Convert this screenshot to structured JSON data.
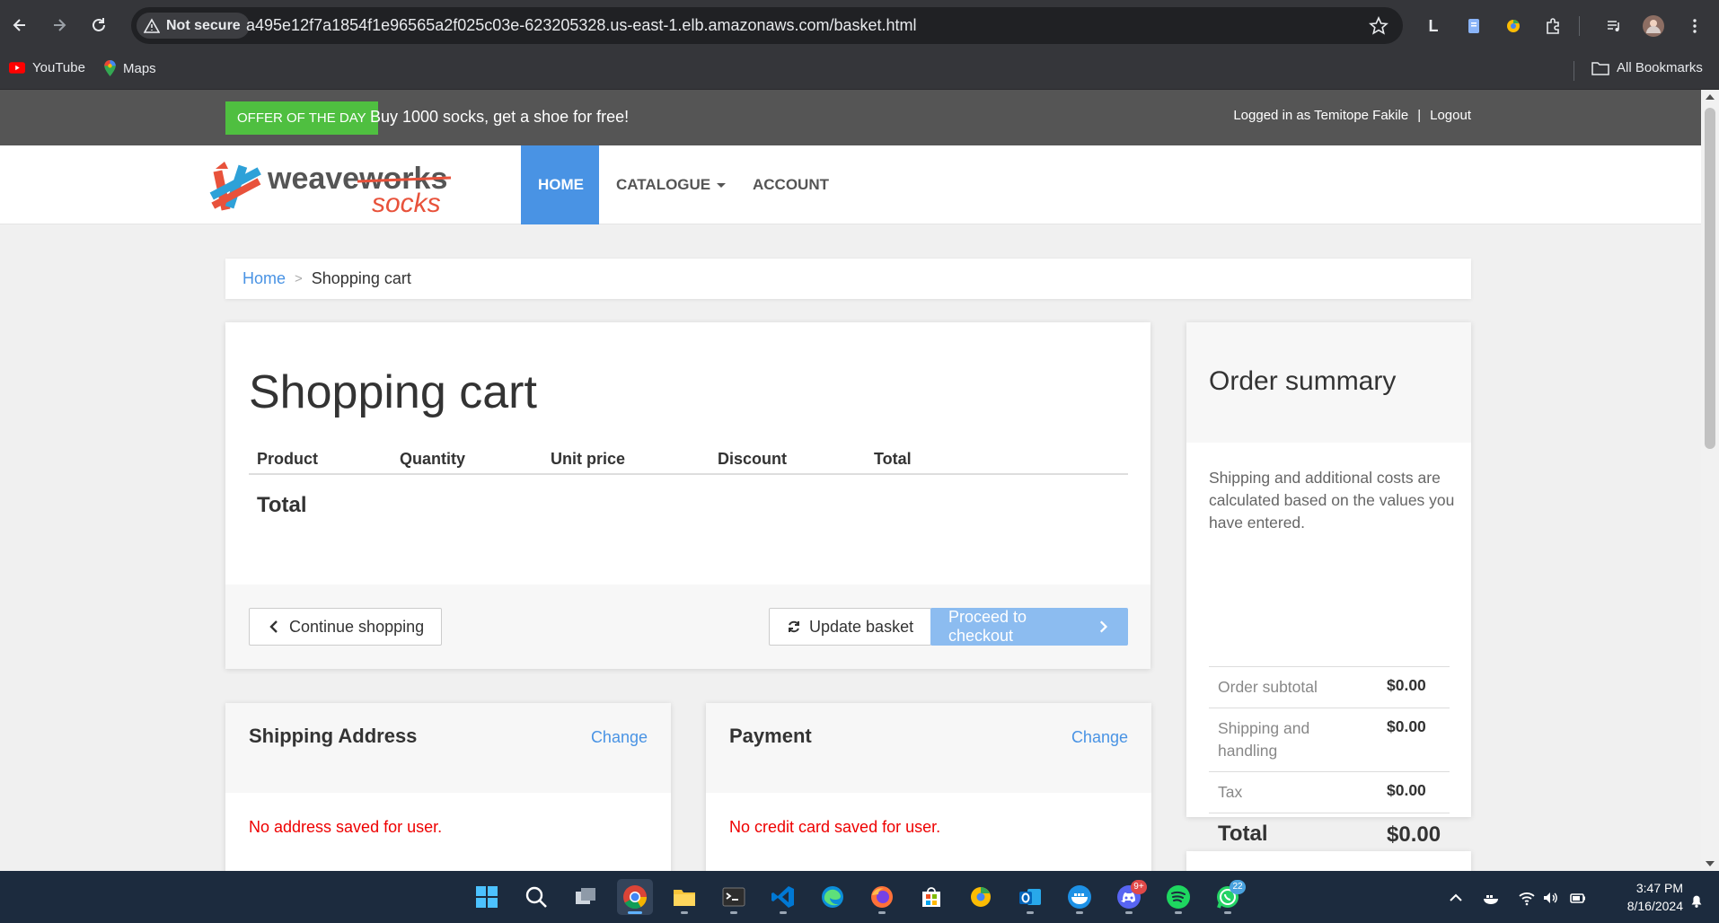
{
  "browser": {
    "security_label": "Not secure",
    "url": "a495e12f7a1854f1e96565a2f025c03e-623205328.us-east-1.elb.amazonaws.com/basket.html",
    "extension_letter": "L",
    "bookmarks": [
      {
        "label": "YouTube",
        "icon": "youtube-icon"
      },
      {
        "label": "Maps",
        "icon": "maps-icon"
      }
    ],
    "all_bookmarks_label": "All Bookmarks"
  },
  "page": {
    "offer": {
      "badge": "Offer of the day",
      "text": "Buy 1000 socks, get a shoe for free!"
    },
    "login": {
      "text": "Logged in as Temitope Fakile",
      "separator": "|",
      "logout": "Logout"
    },
    "logo": {
      "line1": "weaveworks",
      "line2": "socks"
    },
    "nav": [
      {
        "label": "Home",
        "active": true
      },
      {
        "label": "Catalogue",
        "dropdown": true
      },
      {
        "label": "Account"
      }
    ],
    "breadcrumb": {
      "home": "Home",
      "separator": ">",
      "current": "Shopping cart"
    },
    "cart": {
      "title": "Shopping cart",
      "columns": [
        "Product",
        "Quantity",
        "Unit price",
        "Discount",
        "Total"
      ],
      "total_label": "Total",
      "buttons": {
        "continue": "Continue shopping",
        "update": "Update basket",
        "checkout": "Proceed to checkout"
      }
    },
    "summary": {
      "title": "Order summary",
      "description": "Shipping and additional costs are calculated based on the values you have entered.",
      "rows": [
        {
          "label": "Order subtotal",
          "value": "$0.00"
        },
        {
          "label": "Shipping and handling",
          "value": "$0.00"
        },
        {
          "label": "Tax",
          "value": "$0.00"
        }
      ],
      "total": {
        "label": "Total",
        "value": "$0.00"
      }
    },
    "shipping": {
      "title": "Shipping Address",
      "change": "Change",
      "message": "No address saved for user."
    },
    "payment": {
      "title": "Payment",
      "change": "Change",
      "message": "No credit card saved for user."
    }
  },
  "taskbar": {
    "apps": [
      {
        "name": "windows-start-icon"
      },
      {
        "name": "search-icon"
      },
      {
        "name": "task-view-icon"
      },
      {
        "name": "chrome-icon",
        "active": true
      },
      {
        "name": "file-explorer-icon"
      },
      {
        "name": "terminal-icon"
      },
      {
        "name": "vscode-icon"
      },
      {
        "name": "edge-icon"
      },
      {
        "name": "firefox-icon"
      },
      {
        "name": "microsoft-store-icon"
      },
      {
        "name": "chrome-canary-icon"
      },
      {
        "name": "outlook-icon"
      },
      {
        "name": "docker-icon"
      },
      {
        "name": "discord-icon",
        "badge": "9+"
      },
      {
        "name": "spotify-icon"
      },
      {
        "name": "whatsapp-icon",
        "badge": "22"
      }
    ],
    "time": "3:47 PM",
    "date": "8/16/2024"
  }
}
